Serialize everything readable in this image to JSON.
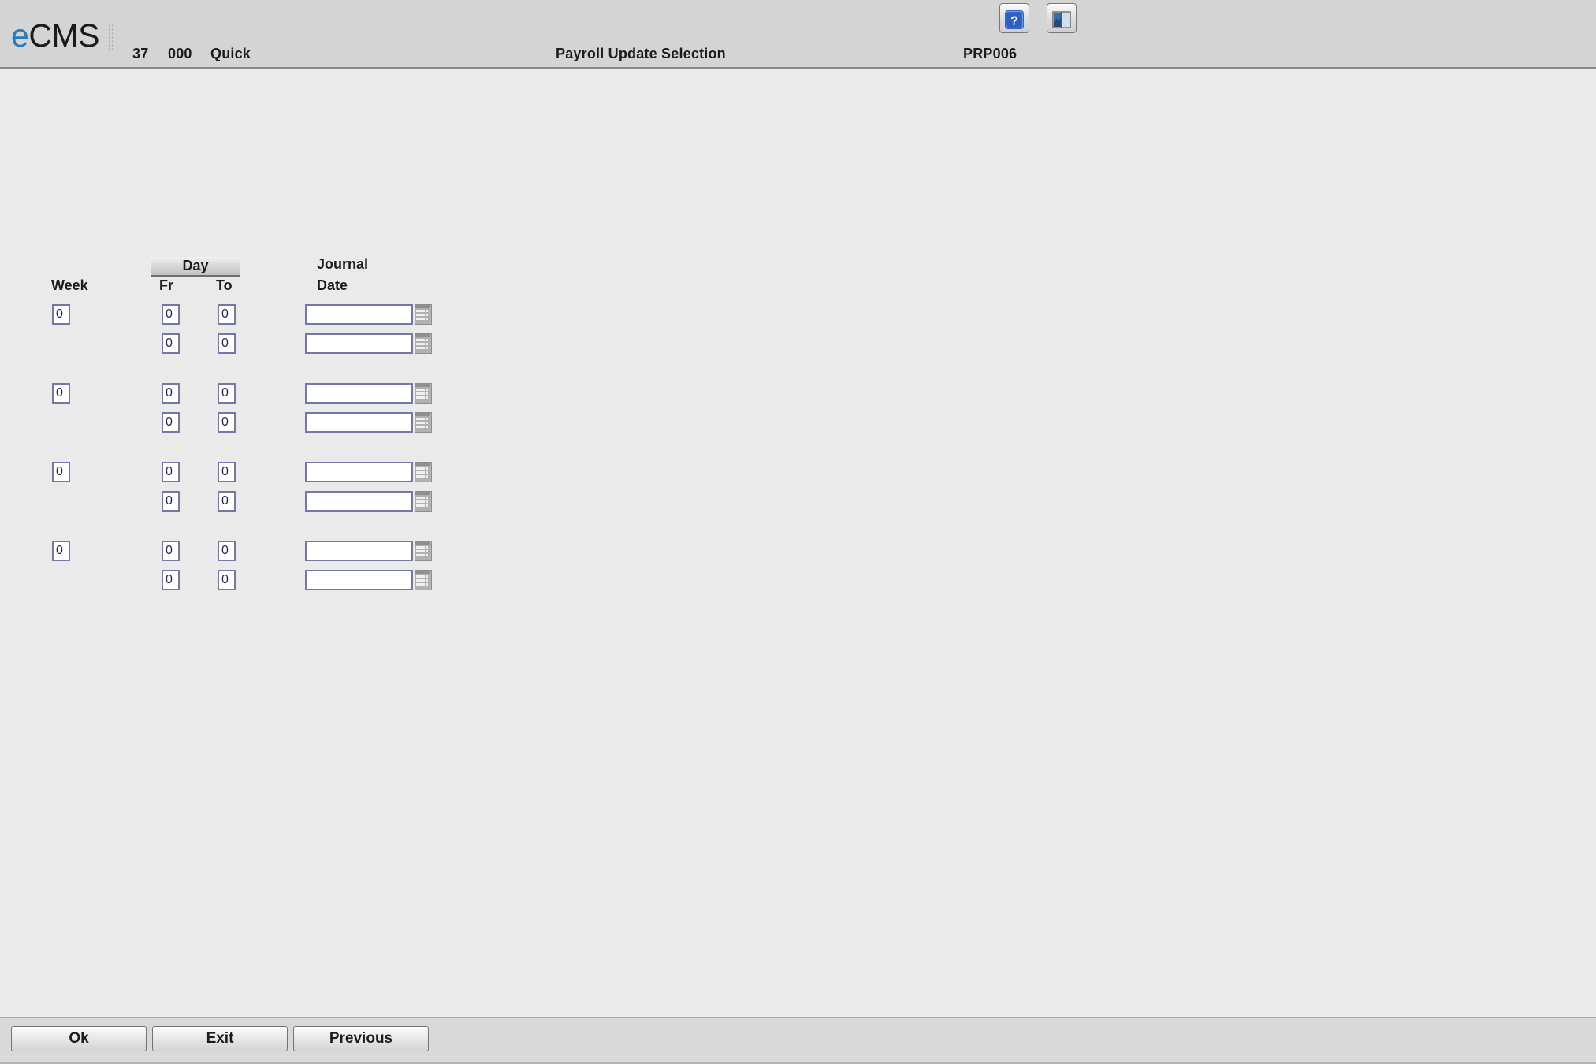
{
  "header": {
    "logo_e": "e",
    "logo_cms": "CMS",
    "company": "37",
    "division": "000",
    "user": "Quick",
    "title": "Payroll Update Selection",
    "program_id": "PRP006",
    "help_icon": "help-question-icon",
    "panel_icon": "split-panel-icon",
    "bg_color": "#d4d4d4",
    "accent_color": "#2a7ab9"
  },
  "form": {
    "labels": {
      "week": "Week",
      "day": "Day",
      "fr": "Fr",
      "to": "To",
      "journal": "Journal",
      "date": "Date"
    },
    "field_border_color": "#7577a6",
    "calendar_icon": "calendar-grid-icon",
    "date_placeholder": "",
    "groups": [
      {
        "week": "0",
        "rows": [
          {
            "fr": "0",
            "to": "0",
            "journal_date": ""
          },
          {
            "fr": "0",
            "to": "0",
            "journal_date": ""
          }
        ]
      },
      {
        "week": "0",
        "rows": [
          {
            "fr": "0",
            "to": "0",
            "journal_date": ""
          },
          {
            "fr": "0",
            "to": "0",
            "journal_date": ""
          }
        ]
      },
      {
        "week": "0",
        "rows": [
          {
            "fr": "0",
            "to": "0",
            "journal_date": ""
          },
          {
            "fr": "0",
            "to": "0",
            "journal_date": ""
          }
        ]
      },
      {
        "week": "0",
        "rows": [
          {
            "fr": "0",
            "to": "0",
            "journal_date": ""
          },
          {
            "fr": "0",
            "to": "0",
            "journal_date": ""
          }
        ]
      }
    ]
  },
  "footer": {
    "ok_label": "Ok",
    "exit_label": "Exit",
    "previous_label": "Previous"
  }
}
